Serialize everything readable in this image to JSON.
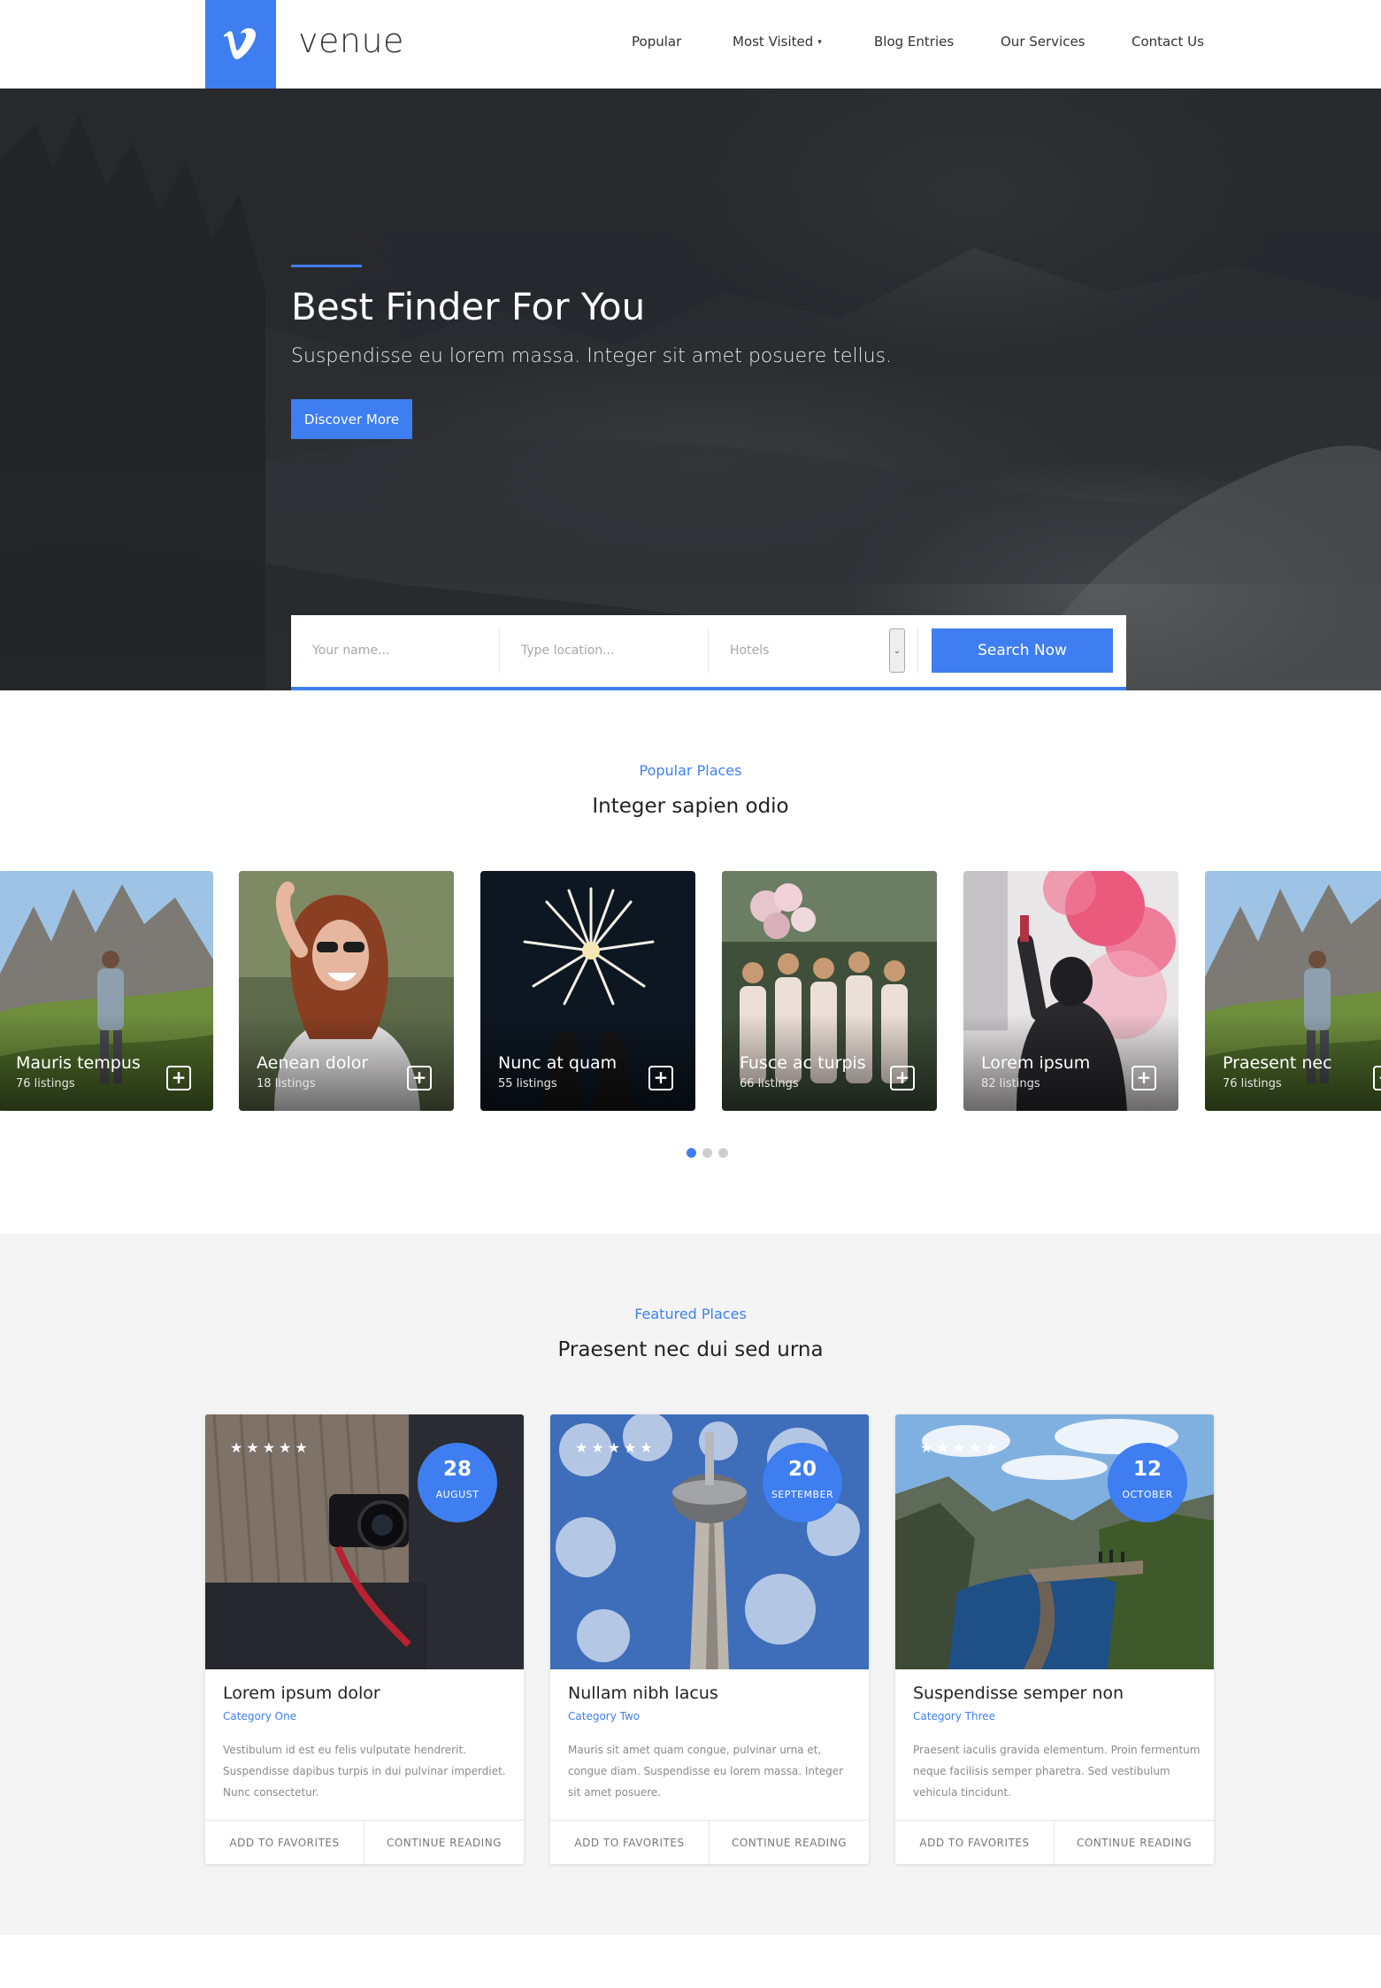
{
  "header": {
    "logo_letter": "v",
    "brand": "venue",
    "nav": [
      {
        "label": "Popular"
      },
      {
        "label": "Most Visited",
        "has_dropdown": true
      },
      {
        "label": "Blog Entries"
      },
      {
        "label": "Our Services"
      },
      {
        "label": "Contact Us"
      }
    ],
    "caret": "▾"
  },
  "hero": {
    "title": "Best Finder For You",
    "subtitle": "Suspendisse eu lorem massa. Integer sit amet posuere tellus.",
    "button_label": "Discover More"
  },
  "search": {
    "name_placeholder": "Your name...",
    "location_placeholder": "Type location...",
    "category_selected": "Hotels",
    "button_label": "Search Now"
  },
  "popular": {
    "kicker": "Popular Places",
    "title": "Integer sapien odio",
    "cards": [
      {
        "name": "Mauris tempus",
        "count": "76 listings",
        "icon": "plus-icon"
      },
      {
        "name": "Aenean dolor",
        "count": "18 listings",
        "icon": "plus-icon"
      },
      {
        "name": "Nunc at quam",
        "count": "55 listings",
        "icon": "plus-icon"
      },
      {
        "name": "Fusce ac turpis",
        "count": "66 listings",
        "icon": "plus-icon"
      },
      {
        "name": "Lorem ipsum",
        "count": "82 listings",
        "icon": "plus-icon"
      },
      {
        "name": "Praesent nec",
        "count": "76 listings",
        "icon": "plus-icon"
      }
    ],
    "plus_glyph": "+",
    "carousel_pages": 3,
    "carousel_active": 1
  },
  "featured": {
    "kicker": "Featured Places",
    "title": "Praesent nec dui sed urna",
    "stars": "★★★★★",
    "cards": [
      {
        "day": "28",
        "month": "AUGUST",
        "title": "Lorem ipsum dolor",
        "category": "Category One",
        "description": "Vestibulum id est eu felis vulputate hendrerit. Suspendisse dapibus turpis in dui pulvinar imperdiet. Nunc consectetur.",
        "fav_label": "ADD TO FAVORITES",
        "read_label": "CONTINUE READING"
      },
      {
        "day": "20",
        "month": "SEPTEMBER",
        "title": "Nullam nibh lacus",
        "category": "Category Two",
        "description": "Mauris sit amet quam congue, pulvinar urna et, congue diam. Suspendisse eu lorem massa. Integer sit amet posuere.",
        "fav_label": "ADD TO FAVORITES",
        "read_label": "CONTINUE READING"
      },
      {
        "day": "12",
        "month": "OCTOBER",
        "title": "Suspendisse semper non",
        "category": "Category Three",
        "description": "Praesent iaculis gravida elementum. Proin fermentum neque facilisis semper pharetra. Sed vestibulum vehicula tincidunt.",
        "fav_label": "ADD TO FAVORITES",
        "read_label": "CONTINUE READING"
      }
    ]
  },
  "colors": {
    "accent": "#3f7ef0",
    "section_bg": "#f4f4f4",
    "text_dark": "#222222",
    "text_muted": "#8a8a8a"
  }
}
